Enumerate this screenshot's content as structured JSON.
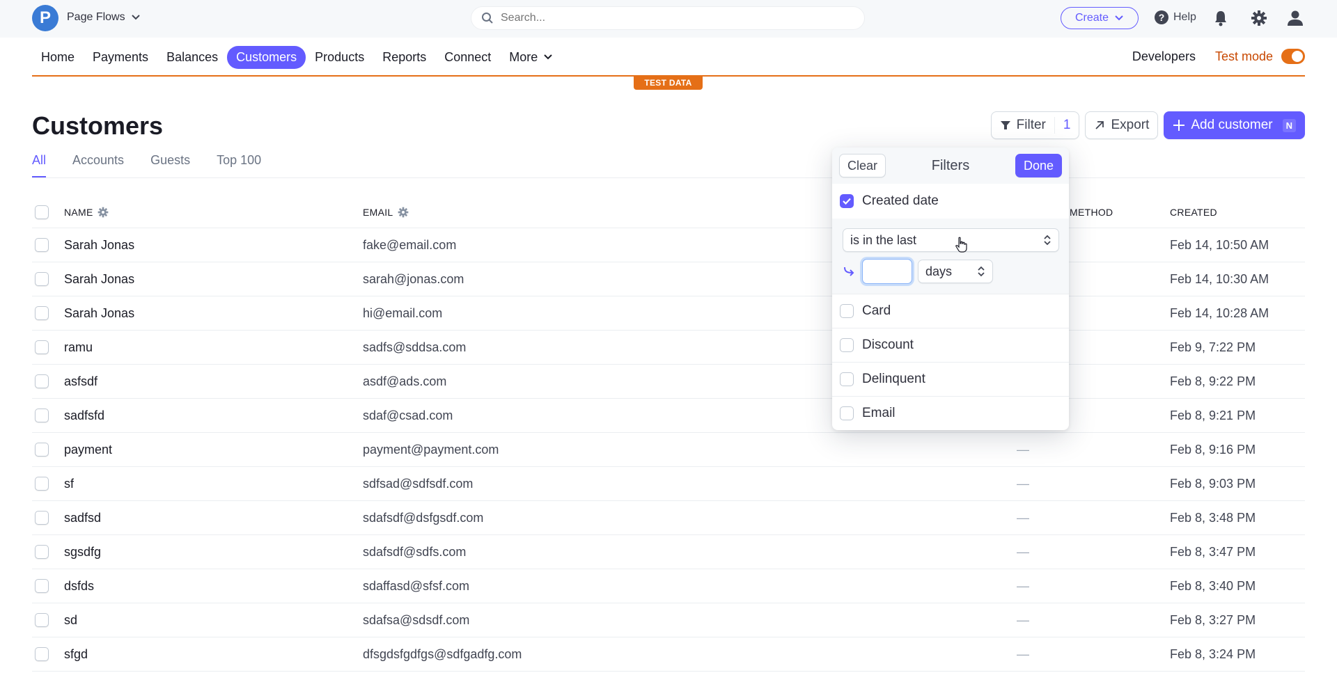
{
  "topbar": {
    "logo_letter": "P",
    "account_name": "Page Flows",
    "search_placeholder": "Search...",
    "create_label": "Create",
    "help_label": "Help",
    "icons": [
      "bell-icon",
      "gear-icon",
      "user-icon"
    ]
  },
  "nav": {
    "items": [
      {
        "label": "Home"
      },
      {
        "label": "Payments"
      },
      {
        "label": "Balances"
      },
      {
        "label": "Customers",
        "active": true
      },
      {
        "label": "Products"
      },
      {
        "label": "Reports"
      },
      {
        "label": "Connect"
      },
      {
        "label": "More"
      }
    ],
    "developers_label": "Developers",
    "test_mode_label": "Test mode",
    "test_mode_on": true,
    "test_data_badge": "TEST DATA"
  },
  "page": {
    "title": "Customers",
    "filter_label": "Filter",
    "filter_count": "1",
    "export_label": "Export",
    "add_label": "Add customer",
    "add_shortcut": "N"
  },
  "tabs": [
    {
      "label": "All",
      "active": true
    },
    {
      "label": "Accounts"
    },
    {
      "label": "Guests"
    },
    {
      "label": "Top 100"
    }
  ],
  "table": {
    "columns": {
      "name": "NAME",
      "email": "EMAIL",
      "payment_method": "METHOD",
      "created": "CREATED"
    },
    "rows": [
      {
        "name": "Sarah Jonas",
        "email": "fake@email.com",
        "pm": "",
        "created": "Feb 14, 10:50 AM"
      },
      {
        "name": "Sarah Jonas",
        "email": "sarah@jonas.com",
        "pm": "",
        "created": "Feb 14, 10:30 AM"
      },
      {
        "name": "Sarah Jonas",
        "email": "hi@email.com",
        "pm": "",
        "created": "Feb 14, 10:28 AM"
      },
      {
        "name": "ramu",
        "email": "sadfs@sddsa.com",
        "pm": "",
        "created": "Feb 9, 7:22 PM"
      },
      {
        "name": "asfsdf",
        "email": "asdf@ads.com",
        "pm": "",
        "created": "Feb 8, 9:22 PM"
      },
      {
        "name": "sadfsfd",
        "email": "sdaf@csad.com",
        "pm": "",
        "created": "Feb 8, 9:21 PM"
      },
      {
        "name": "payment",
        "email": "payment@payment.com",
        "pm": "—",
        "created": "Feb 8, 9:16 PM"
      },
      {
        "name": "sf",
        "email": "sdfsad@sdfsdf.com",
        "pm": "—",
        "created": "Feb 8, 9:03 PM"
      },
      {
        "name": "sadfsd",
        "email": "sdafsdf@dsfgsdf.com",
        "pm": "—",
        "created": "Feb 8, 3:48 PM"
      },
      {
        "name": "sgsdfg",
        "email": "sdafsdf@sdfs.com",
        "pm": "—",
        "created": "Feb 8, 3:47 PM"
      },
      {
        "name": "dsfds",
        "email": "sdaffasd@sfsf.com",
        "pm": "—",
        "created": "Feb 8, 3:40 PM"
      },
      {
        "name": "sd",
        "email": "sdafsa@sdsdf.com",
        "pm": "—",
        "created": "Feb 8, 3:27 PM"
      },
      {
        "name": "sfgd",
        "email": "dfsgdsfgdfgs@sdfgadfg.com",
        "pm": "—",
        "created": "Feb 8, 3:24 PM"
      }
    ]
  },
  "filters": {
    "title": "Filters",
    "clear_label": "Clear",
    "done_label": "Done",
    "created_date": {
      "label": "Created date",
      "checked": true,
      "operator": "is in the last",
      "value": "",
      "unit": "days"
    },
    "options": [
      {
        "label": "Card",
        "checked": false
      },
      {
        "label": "Discount",
        "checked": false
      },
      {
        "label": "Delinquent",
        "checked": false
      },
      {
        "label": "Email",
        "checked": false
      }
    ]
  },
  "colors": {
    "accent": "#635bff",
    "test_mode": "#e56f17"
  }
}
